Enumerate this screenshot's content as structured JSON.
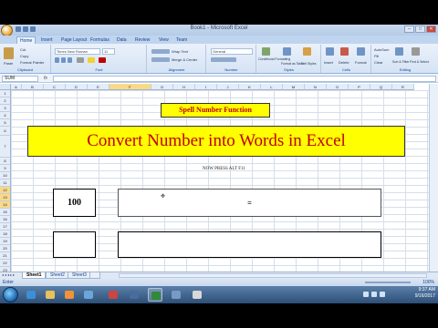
{
  "window": {
    "title": "Book1 - Microsoft Excel",
    "controls": {
      "minimize": "–",
      "maximize": "□",
      "close": "✕"
    }
  },
  "ribbon": {
    "tabs": [
      "Home",
      "Insert",
      "Page Layout",
      "Formulas",
      "Data",
      "Review",
      "View",
      "Team"
    ],
    "active_tab": "Home",
    "groups": [
      "Clipboard",
      "Font",
      "Alignment",
      "Number",
      "Styles",
      "Cells",
      "Editing"
    ],
    "clipboard": {
      "paste": "Paste",
      "cut": "Cut",
      "copy": "Copy",
      "format_painter": "Format Painter"
    },
    "font": {
      "name": "Times New Roman",
      "size": "11"
    },
    "alignment": {
      "wrap": "Wrap Text",
      "merge": "Merge & Center"
    },
    "number": {
      "format": "General"
    },
    "styles": {
      "conditional": "Conditional Formatting",
      "table": "Format as Table",
      "cell": "Cell Styles"
    },
    "cells": {
      "insert": "Insert",
      "delete": "Delete",
      "format": "Format"
    },
    "editing": {
      "autosum": "AutoSum",
      "fill": "Fill",
      "clear": "Clear",
      "sort": "Sort & Filter",
      "find": "Find & Select"
    }
  },
  "formula_bar": {
    "name_box": "SUM",
    "fx": "fx",
    "content": ""
  },
  "columns": [
    "A",
    "B",
    "C",
    "D",
    "E",
    "F",
    "G",
    "H",
    "I",
    "J",
    "K",
    "L",
    "M",
    "N",
    "O",
    "P",
    "Q",
    "R"
  ],
  "selected_column": "F",
  "rows": [
    "1",
    "2",
    "3",
    "4",
    "5",
    "6",
    "7",
    "8",
    "9",
    "10",
    "11",
    "12",
    "13",
    "14",
    "15",
    "16",
    "17",
    "18",
    "19",
    "20",
    "21",
    "22",
    "23"
  ],
  "selected_rows": [
    "12",
    "13",
    "14"
  ],
  "sheet": {
    "spell_title": "Spell Number Function",
    "headline": "Convert Number into Words in Excel",
    "instruction": "NOW  PRESS ALT F11",
    "number_value": "100",
    "result_formula": "="
  },
  "sheet_tabs": [
    "Sheet1",
    "Sheet2",
    "Sheet3"
  ],
  "active_sheet": "Sheet1",
  "status": {
    "mode": "Enter",
    "zoom": "100%"
  },
  "taskbar": {
    "time": "9:37 AM",
    "date": "9/16/2017"
  },
  "colors": {
    "highlight": "#ffff00",
    "red_text": "#c00000"
  }
}
